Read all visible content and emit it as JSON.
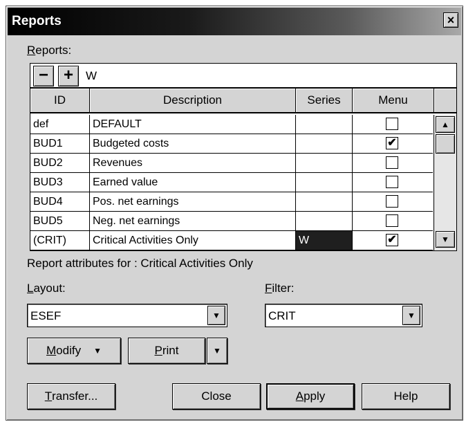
{
  "window": {
    "title": "Reports",
    "close_glyph": "×"
  },
  "reports": {
    "label_prefix": "R",
    "label_rest": "eports:",
    "edit_value": "W",
    "minus_glyph": "−",
    "plus_glyph": "+",
    "columns": [
      "ID",
      "Description",
      "Series",
      "Menu"
    ],
    "rows": [
      {
        "id": "def",
        "description": "DEFAULT",
        "series": "",
        "menu": false
      },
      {
        "id": "BUD1",
        "description": "Budgeted costs",
        "series": "",
        "menu": true
      },
      {
        "id": "BUD2",
        "description": "Revenues",
        "series": "",
        "menu": false
      },
      {
        "id": "BUD3",
        "description": "Earned value",
        "series": "",
        "menu": false
      },
      {
        "id": "BUD4",
        "description": "Pos. net earnings",
        "series": "",
        "menu": false
      },
      {
        "id": "BUD5",
        "description": "Neg. net earnings",
        "series": "",
        "menu": false
      },
      {
        "id": "(CRIT)",
        "description": "Critical Activities Only",
        "series": "W",
        "menu": true
      }
    ],
    "selected_row": 6
  },
  "attributes_text": "Report attributes for : Critical Activities Only",
  "layout": {
    "label_prefix": "L",
    "label_rest": "ayout:",
    "value": "ESEF"
  },
  "filter": {
    "label_prefix": "F",
    "label_rest": "ilter:",
    "value": "CRIT"
  },
  "buttons": {
    "modify_prefix": "M",
    "modify_rest": "odify",
    "print_prefix": "P",
    "print_rest": "rint",
    "transfer_prefix": "T",
    "transfer_rest": "ransfer...",
    "close": "Close",
    "apply_prefix": "A",
    "apply_rest": "pply",
    "help": "Help"
  },
  "icons": {
    "check": "✔",
    "down_arrow": "▼",
    "up_arrow": "▲"
  }
}
